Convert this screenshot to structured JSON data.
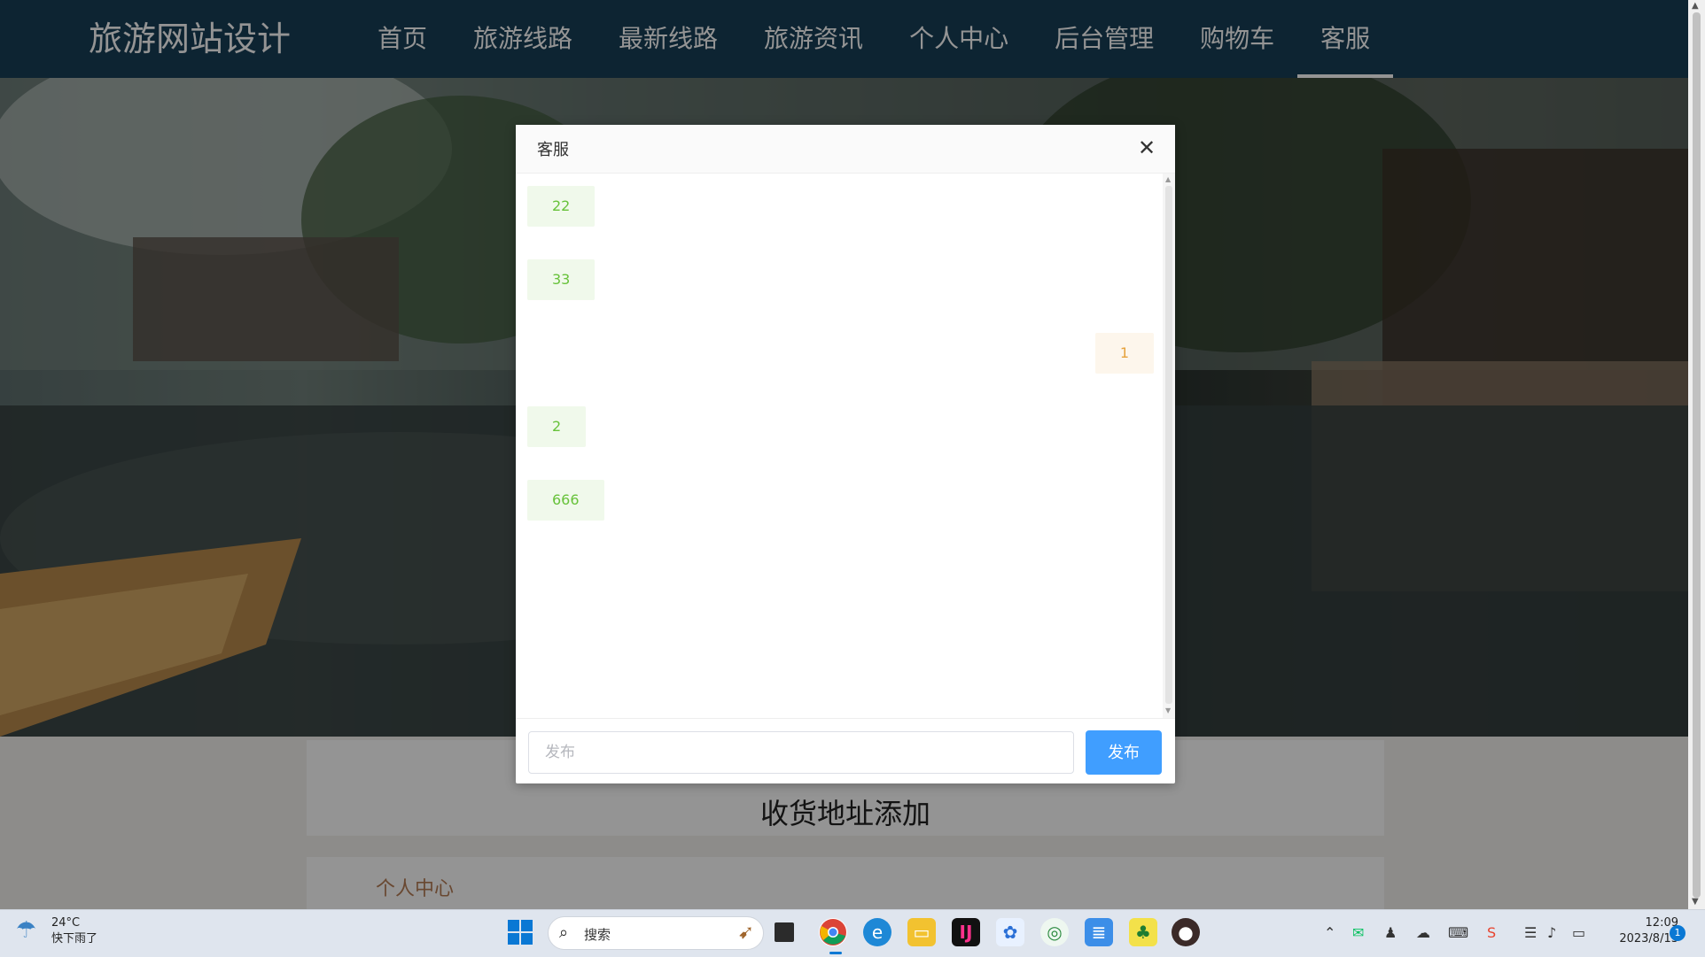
{
  "site": {
    "title": "旅游网站设计",
    "nav": [
      {
        "label": "首页"
      },
      {
        "label": "旅游线路"
      },
      {
        "label": "最新线路"
      },
      {
        "label": "旅游资讯"
      },
      {
        "label": "个人中心"
      },
      {
        "label": "后台管理"
      },
      {
        "label": "购物车"
      },
      {
        "label": "客服",
        "active": true
      }
    ]
  },
  "page": {
    "section_title": "收货地址添加",
    "section_subtitle": "个人中心"
  },
  "dialog": {
    "title": "客服",
    "messages": [
      {
        "text": "22",
        "side": "left"
      },
      {
        "text": "33",
        "side": "left"
      },
      {
        "text": "1",
        "side": "right"
      },
      {
        "text": "2",
        "side": "left"
      },
      {
        "text": "666",
        "side": "left"
      }
    ],
    "input_placeholder": "发布",
    "input_value": "",
    "send_label": "发布"
  },
  "colors": {
    "navbar": "#173e56",
    "left_bubble_bg": "#f0f9eb",
    "left_bubble_text": "#67c23a",
    "right_bubble_bg": "#fdf6ec",
    "right_bubble_text": "#e6a23c",
    "primary_button": "#409eff"
  },
  "taskbar": {
    "weather": {
      "temp": "24°C",
      "desc": "快下雨了"
    },
    "search_placeholder": "搜索",
    "apps": [
      "task-view",
      "chrome",
      "edge",
      "file-explorer",
      "intellij",
      "app-blue",
      "app-colorful",
      "notepad",
      "app-green",
      "avatar-app"
    ],
    "clock": {
      "time": "12:09",
      "date": "2023/8/13"
    },
    "notification_count": "1"
  }
}
